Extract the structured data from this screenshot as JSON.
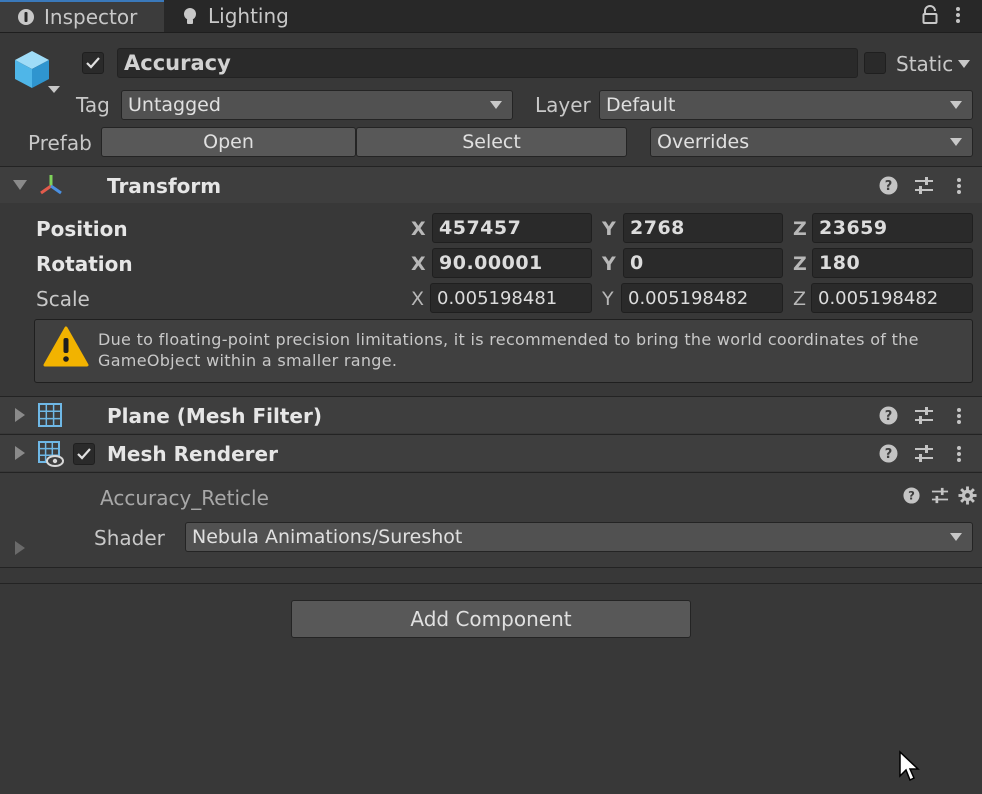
{
  "tabs": [
    {
      "label": "Inspector",
      "icon": "info-icon"
    },
    {
      "label": "Lighting",
      "icon": "bulb-icon"
    }
  ],
  "header": {
    "object_name": "Accuracy",
    "active_checked": true,
    "static_label": "Static",
    "tag_label": "Tag",
    "tag_value": "Untagged",
    "layer_label": "Layer",
    "layer_value": "Default",
    "prefab_label": "Prefab",
    "open_label": "Open",
    "select_label": "Select",
    "overrides_label": "Overrides"
  },
  "transform": {
    "title": "Transform",
    "position_label": "Position",
    "rotation_label": "Rotation",
    "scale_label": "Scale",
    "position": {
      "x": "457457",
      "y": "2768",
      "z": "23659"
    },
    "rotation": {
      "x": "90.00001",
      "y": "0",
      "z": "180"
    },
    "scale": {
      "x": "0.005198481",
      "y": "0.005198482",
      "z": "0.005198482"
    },
    "axis_x": "X",
    "axis_y": "Y",
    "axis_z": "Z",
    "warning_line1": "Due to floating-point precision limitations, it is recommended to bring the world coordinates of the",
    "warning_line2": "GameObject within a smaller range."
  },
  "mesh_filter": {
    "title": "Plane (Mesh Filter)"
  },
  "mesh_renderer": {
    "title": "Mesh Renderer",
    "enabled": true
  },
  "material": {
    "name": "Accuracy_Reticle",
    "shader_label": "Shader",
    "shader_value": "Nebula Animations/Sureshot"
  },
  "add_component_label": "Add Component",
  "colors": {
    "accent": "#3a79bb",
    "warning": "#f2b300",
    "background": "#383838"
  }
}
